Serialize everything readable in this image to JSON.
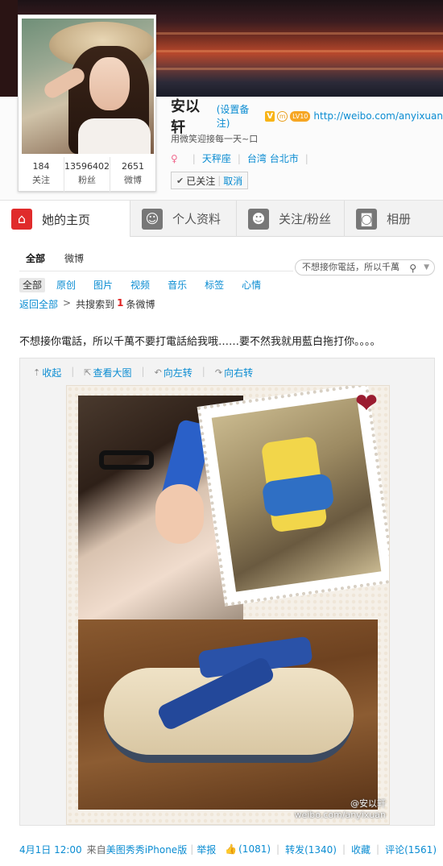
{
  "profile": {
    "name": "安以轩",
    "remark_link": "(设置备注)",
    "verified_badge": "V",
    "member_badge": "m",
    "level_badge": "LV10",
    "homepage_url": "http://weibo.com/anyixuan",
    "bio": "用微笑迎接每一天~口",
    "gender_icon": "female-icon",
    "zodiac": "天秤座",
    "location": "台湾 台北市",
    "follow_state": "已关注",
    "cancel_label": "取消",
    "stats": [
      {
        "num": "184",
        "label": "关注"
      },
      {
        "num": "13596402",
        "label": "粉丝"
      },
      {
        "num": "2651",
        "label": "微博"
      }
    ]
  },
  "tabs": [
    {
      "label": "她的主页",
      "icon": "home-icon",
      "glyph": "⌂",
      "active": true
    },
    {
      "label": "个人资料",
      "icon": "profile-icon",
      "glyph": "☺",
      "active": false
    },
    {
      "label": "关注/粉丝",
      "icon": "followers-icon",
      "glyph": "☻",
      "active": false
    },
    {
      "label": "相册",
      "icon": "camera-icon",
      "glyph": "◙",
      "active": false
    }
  ],
  "feed": {
    "subtabs": [
      {
        "label": "全部",
        "active": true
      },
      {
        "label": "微博",
        "active": false
      }
    ],
    "search": {
      "value": "不想接你電話，所以千萬",
      "icon": "search-icon"
    },
    "filters": [
      {
        "label": "全部",
        "active": true
      },
      {
        "label": "原创",
        "active": false
      },
      {
        "label": "图片",
        "active": false
      },
      {
        "label": "视频",
        "active": false
      },
      {
        "label": "音乐",
        "active": false
      },
      {
        "label": "标签",
        "active": false
      },
      {
        "label": "心情",
        "active": false
      }
    ],
    "crumbs": {
      "back": "返回全部",
      "prefix": "共搜索到",
      "count": "1",
      "suffix": "条微博"
    },
    "post": {
      "text": "不想接你電話，所以千萬不要打電話給我哦……要不然我就用藍白拖打你。。。。",
      "tools": [
        {
          "label": "收起",
          "icon": "collapse-icon",
          "glyph": "⇡"
        },
        {
          "label": "查看大图",
          "icon": "zoom-icon",
          "glyph": "⇱"
        },
        {
          "label": "向左转",
          "icon": "rotate-left-icon",
          "glyph": "↶"
        },
        {
          "label": "向右转",
          "icon": "rotate-right-icon",
          "glyph": "↷"
        }
      ],
      "watermark_line1": "@安以轩",
      "watermark_line2": "weibo.com/anyixuan",
      "time": "4月1日 12:00",
      "from_prefix": "来自",
      "from_app": "美图秀秀iPhone版",
      "report": "举报",
      "like": "(1081)",
      "repost": "转发(1340)",
      "favorite": "收藏",
      "comment": "评论(1561)"
    }
  },
  "colors": {
    "link": "#0a8cd2",
    "active_tab_icon": "#e02b2b",
    "count_highlight": "#e02020"
  }
}
